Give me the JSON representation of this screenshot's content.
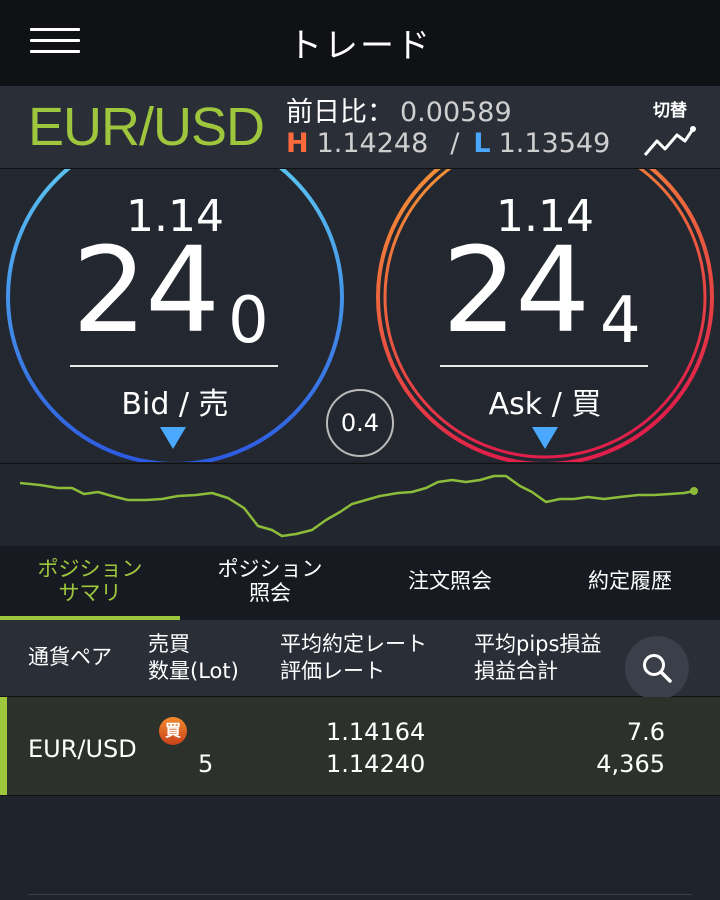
{
  "header": {
    "title": "トレード"
  },
  "pair": {
    "name": "EUR/USD",
    "change_label": "前日比：",
    "change_value": "0.00589",
    "high_label": "H",
    "high_value": "1.14248",
    "separator": "/",
    "low_label": "L",
    "low_value": "1.13549",
    "switch_label": "切替"
  },
  "bid": {
    "top": "1.14",
    "big": "24",
    "small": "0",
    "label": "Bid / 売"
  },
  "ask": {
    "top": "1.14",
    "big": "24",
    "small": "4",
    "label": "Ask / 買"
  },
  "spread": "0.4",
  "tabs": [
    {
      "line1": "ポジション",
      "line2": "サマリ"
    },
    {
      "line1": "ポジション",
      "line2": "照会"
    },
    {
      "line1": "注文照会",
      "line2": ""
    },
    {
      "line1": "約定履歴",
      "line2": ""
    }
  ],
  "table": {
    "headers": {
      "pair": "通貨ペア",
      "side_line1": "売買",
      "side_line2": "数量(Lot)",
      "rate_line1": "平均約定レート",
      "rate_line2": "評価レート",
      "pl_line1": "平均pips損益",
      "pl_line2": "損益合計"
    },
    "rows": [
      {
        "pair": "EUR/USD",
        "side": "買",
        "quantity": "5",
        "avg_rate": "1.14164",
        "eval_rate": "1.14240",
        "avg_pips": "7.6",
        "total_pl": "4,365"
      }
    ]
  },
  "colors": {
    "accent": "#9ec73d",
    "high": "#ff6a3d",
    "low": "#4aa8ff",
    "bid_ring": "#3a8df0",
    "ask_ring": "#e8433a"
  },
  "icons": {
    "menu": "hamburger-menu-icon",
    "switch": "trend-chart-icon",
    "search": "search-icon",
    "bid_arrow": "triangle-down-icon",
    "ask_arrow": "triangle-down-icon"
  }
}
